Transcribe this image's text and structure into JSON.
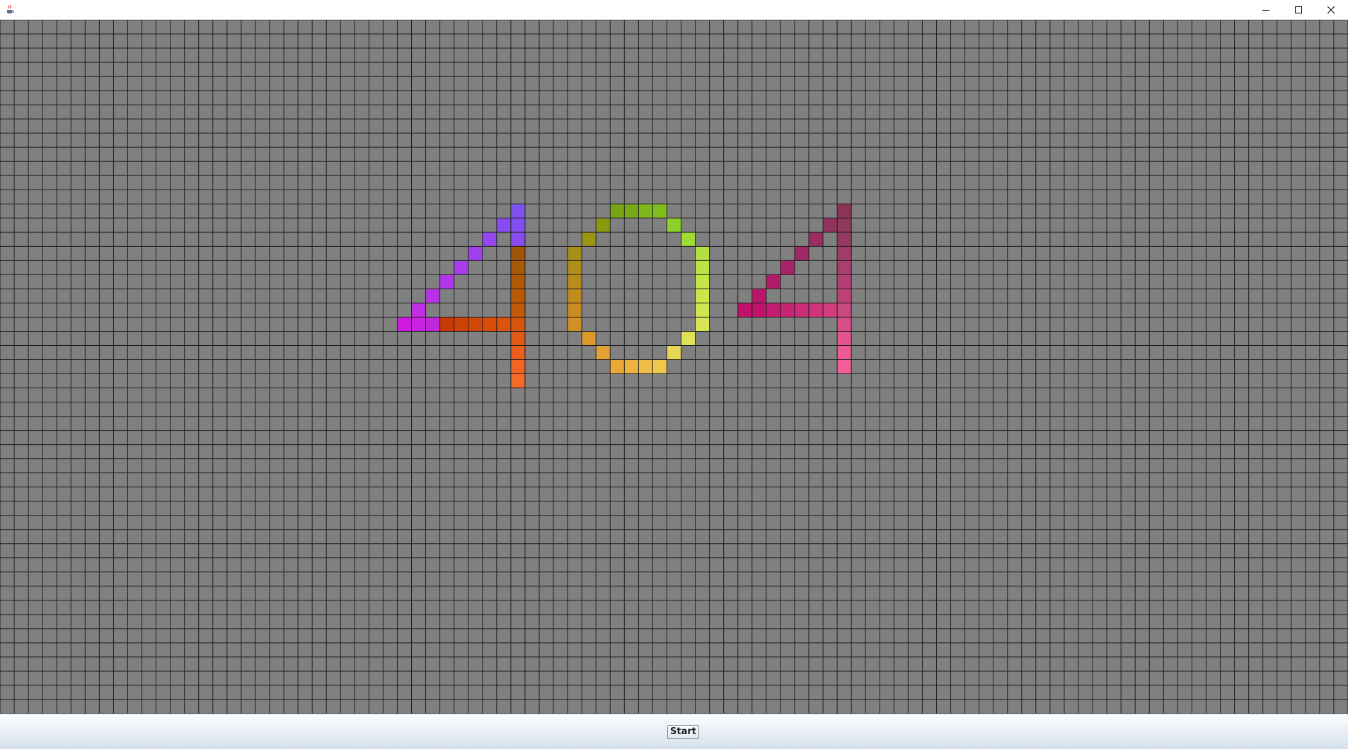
{
  "window": {
    "icons": {
      "app": "java-cup-icon",
      "minimize": "minimize-icon",
      "maximize": "maximize-icon",
      "close": "close-icon"
    }
  },
  "grid": {
    "columns": 95,
    "rows": 49,
    "background_color": "#808080",
    "line_color": "#1e1e1e",
    "cells": [
      {
        "col": 36,
        "row": 13,
        "color": "#7f52f0"
      },
      {
        "col": 35,
        "row": 14,
        "color": "#8a4cf0"
      },
      {
        "col": 36,
        "row": 14,
        "color": "#8250f0"
      },
      {
        "col": 34,
        "row": 15,
        "color": "#9646ee"
      },
      {
        "col": 36,
        "row": 15,
        "color": "#8a4cf0"
      },
      {
        "col": 33,
        "row": 16,
        "color": "#a040ec"
      },
      {
        "col": 36,
        "row": 16,
        "color": "#a05608"
      },
      {
        "col": 32,
        "row": 17,
        "color": "#a83cea"
      },
      {
        "col": 36,
        "row": 17,
        "color": "#a85a06"
      },
      {
        "col": 31,
        "row": 18,
        "color": "#b036e8"
      },
      {
        "col": 36,
        "row": 18,
        "color": "#b05806"
      },
      {
        "col": 30,
        "row": 19,
        "color": "#b832e6"
      },
      {
        "col": 36,
        "row": 19,
        "color": "#b85a08"
      },
      {
        "col": 29,
        "row": 20,
        "color": "#c02ee4"
      },
      {
        "col": 36,
        "row": 20,
        "color": "#c05a0a"
      },
      {
        "col": 28,
        "row": 21,
        "color": "#d01ce0"
      },
      {
        "col": 29,
        "row": 21,
        "color": "#c822e0"
      },
      {
        "col": 30,
        "row": 21,
        "color": "#c028dc"
      },
      {
        "col": 31,
        "row": 21,
        "color": "#c83a04"
      },
      {
        "col": 32,
        "row": 21,
        "color": "#cf4206"
      },
      {
        "col": 33,
        "row": 21,
        "color": "#d44608"
      },
      {
        "col": 34,
        "row": 21,
        "color": "#d84c0a"
      },
      {
        "col": 35,
        "row": 21,
        "color": "#dc520e"
      },
      {
        "col": 36,
        "row": 21,
        "color": "#d4560c"
      },
      {
        "col": 36,
        "row": 22,
        "color": "#e05a14"
      },
      {
        "col": 36,
        "row": 23,
        "color": "#ec5e1c"
      },
      {
        "col": 36,
        "row": 24,
        "color": "#f26424"
      },
      {
        "col": 36,
        "row": 25,
        "color": "#f46a28"
      },
      {
        "col": 43,
        "row": 13,
        "color": "#76a414"
      },
      {
        "col": 44,
        "row": 13,
        "color": "#78aa16"
      },
      {
        "col": 45,
        "row": 13,
        "color": "#7cb618"
      },
      {
        "col": 46,
        "row": 13,
        "color": "#80bc1c"
      },
      {
        "col": 42,
        "row": 14,
        "color": "#8c9a12"
      },
      {
        "col": 47,
        "row": 14,
        "color": "#8cd22a"
      },
      {
        "col": 41,
        "row": 15,
        "color": "#9a9614"
      },
      {
        "col": 48,
        "row": 15,
        "color": "#a0dc34"
      },
      {
        "col": 40,
        "row": 16,
        "color": "#a89016"
      },
      {
        "col": 49,
        "row": 16,
        "color": "#b2e03e"
      },
      {
        "col": 40,
        "row": 17,
        "color": "#b08e18"
      },
      {
        "col": 49,
        "row": 17,
        "color": "#bce244"
      },
      {
        "col": 40,
        "row": 18,
        "color": "#b88c1a"
      },
      {
        "col": 49,
        "row": 18,
        "color": "#c4e448"
      },
      {
        "col": 40,
        "row": 19,
        "color": "#c08c1e"
      },
      {
        "col": 49,
        "row": 19,
        "color": "#cce64c"
      },
      {
        "col": 40,
        "row": 20,
        "color": "#c88c20"
      },
      {
        "col": 49,
        "row": 20,
        "color": "#d2e650"
      },
      {
        "col": 40,
        "row": 21,
        "color": "#d09024"
      },
      {
        "col": 49,
        "row": 21,
        "color": "#d8e654"
      },
      {
        "col": 41,
        "row": 22,
        "color": "#dc9a2a"
      },
      {
        "col": 48,
        "row": 22,
        "color": "#e0e256"
      },
      {
        "col": 42,
        "row": 23,
        "color": "#e4a232"
      },
      {
        "col": 47,
        "row": 23,
        "color": "#e6d852"
      },
      {
        "col": 43,
        "row": 24,
        "color": "#eaaa3a"
      },
      {
        "col": 44,
        "row": 24,
        "color": "#eeb442"
      },
      {
        "col": 45,
        "row": 24,
        "color": "#f0bc48"
      },
      {
        "col": 46,
        "row": 24,
        "color": "#eec84c"
      },
      {
        "col": 59,
        "row": 13,
        "color": "#8c3458"
      },
      {
        "col": 58,
        "row": 14,
        "color": "#94325e"
      },
      {
        "col": 59,
        "row": 14,
        "color": "#8e3a5c"
      },
      {
        "col": 57,
        "row": 15,
        "color": "#9a2e62"
      },
      {
        "col": 59,
        "row": 15,
        "color": "#963a62"
      },
      {
        "col": 56,
        "row": 16,
        "color": "#a02864"
      },
      {
        "col": 59,
        "row": 16,
        "color": "#a03c68"
      },
      {
        "col": 55,
        "row": 17,
        "color": "#a82266"
      },
      {
        "col": 59,
        "row": 17,
        "color": "#aa3e6e"
      },
      {
        "col": 54,
        "row": 18,
        "color": "#b01c68"
      },
      {
        "col": 59,
        "row": 18,
        "color": "#b24074"
      },
      {
        "col": 53,
        "row": 19,
        "color": "#b8166a"
      },
      {
        "col": 59,
        "row": 19,
        "color": "#bc4278"
      },
      {
        "col": 52,
        "row": 20,
        "color": "#c0126a"
      },
      {
        "col": 53,
        "row": 20,
        "color": "#c0146c"
      },
      {
        "col": 54,
        "row": 20,
        "color": "#c41c70"
      },
      {
        "col": 55,
        "row": 20,
        "color": "#c82474"
      },
      {
        "col": 56,
        "row": 20,
        "color": "#cc2c78"
      },
      {
        "col": 57,
        "row": 20,
        "color": "#d0347c"
      },
      {
        "col": 58,
        "row": 20,
        "color": "#d43c80"
      },
      {
        "col": 59,
        "row": 20,
        "color": "#c84880"
      },
      {
        "col": 59,
        "row": 21,
        "color": "#d84e88"
      },
      {
        "col": 59,
        "row": 22,
        "color": "#e4548e"
      },
      {
        "col": 59,
        "row": 23,
        "color": "#ee5a94"
      },
      {
        "col": 59,
        "row": 24,
        "color": "#f45e98"
      }
    ]
  },
  "controls": {
    "start_label": "Start"
  }
}
